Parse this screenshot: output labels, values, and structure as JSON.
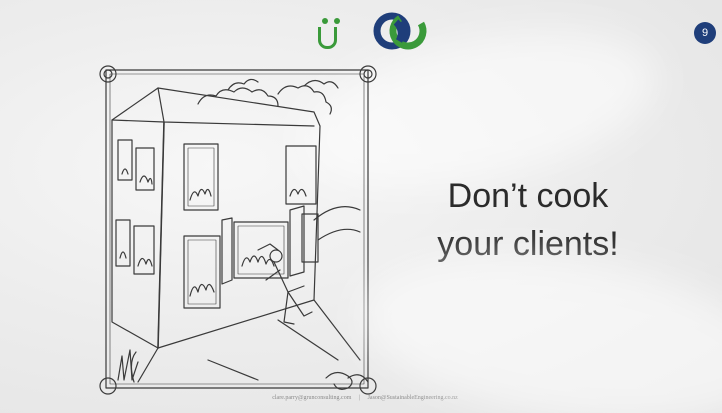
{
  "slide": {
    "page_number": "9",
    "headline_line1": "Don’t cook",
    "headline_line2": "your clients!",
    "footer_email_left": "clare.parry@grunconsulting.com",
    "footer_separator": "|",
    "footer_email_right": "Jason@SustainableEngineering.co.nz"
  },
  "icons": {
    "logo_u": "u-umlaut-logo-icon",
    "logo_cc": "interlocking-c-logo-icon",
    "illustration": "burning-house-illustration"
  },
  "colors": {
    "logo_green": "#3a9a3a",
    "logo_navy": "#1f3e7a",
    "badge": "#1f3e7a",
    "text": "#2b2b2b"
  }
}
